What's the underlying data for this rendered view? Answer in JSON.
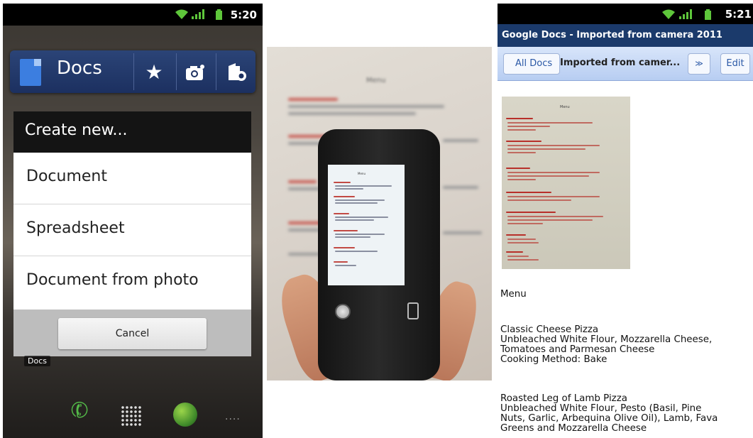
{
  "panel1": {
    "status_time": "5:20",
    "app_title": "Docs",
    "dialog": {
      "title": "Create new...",
      "items": [
        "Document",
        "Spreadsheet",
        "Document from photo"
      ],
      "cancel_label": "Cancel"
    },
    "home_label": "Docs"
  },
  "panel2": {
    "bg_menu_title": "Menu",
    "screen_menu_title": "Menu"
  },
  "panel3": {
    "status_time": "5:21",
    "window_title": "Google Docs - Imported from camera 2011",
    "all_docs_label": "All Docs",
    "doc_name": "Imported from camer...",
    "menu_chevron": "≫",
    "edit_label": "Edit",
    "scan_title": "Menu",
    "content": {
      "heading": "Menu",
      "item1": {
        "name": "Classic Cheese Pizza",
        "line1": "Unbleached White Flour, Mozzarella Cheese,",
        "line2": "Tomatoes and Parmesan Cheese",
        "method": "Cooking Method: Bake"
      },
      "item2": {
        "name": "Roasted Leg of Lamb Pizza",
        "line1": "Unbleached White Flour, Pesto (Basil, Pine",
        "line2": "Nuts, Garlic, Arbequina Olive Oil), Lamb, Fava",
        "line3": "Greens and Mozzarella Cheese"
      }
    }
  },
  "colors": {
    "docs_bar": "#1c3060",
    "title_bar": "#1b3a6b",
    "toolbar": "#b7cdf2",
    "menu_red": "#b8302a"
  }
}
